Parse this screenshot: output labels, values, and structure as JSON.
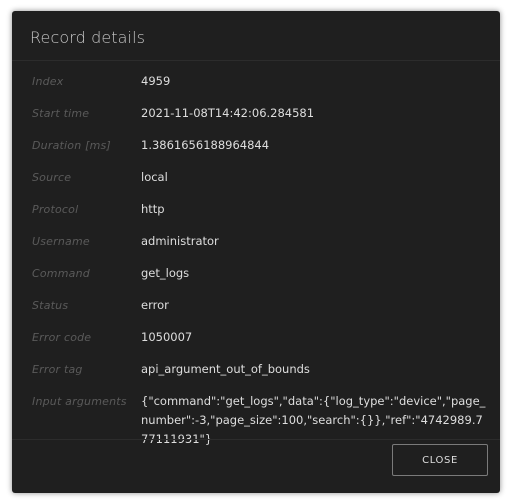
{
  "dialog": {
    "title": "Record details",
    "close_label": "CLOSE"
  },
  "fields": [
    {
      "label": "Index",
      "value": "4959"
    },
    {
      "label": "Start time",
      "value": "2021-11-08T14:42:06.284581"
    },
    {
      "label": "Duration [ms]",
      "value": "1.3861656188964844"
    },
    {
      "label": "Source",
      "value": "local"
    },
    {
      "label": "Protocol",
      "value": "http"
    },
    {
      "label": "Username",
      "value": "administrator"
    },
    {
      "label": "Command",
      "value": "get_logs"
    },
    {
      "label": "Status",
      "value": "error"
    },
    {
      "label": "Error code",
      "value": "1050007"
    },
    {
      "label": "Error tag",
      "value": "api_argument_out_of_bounds"
    },
    {
      "label": "Input arguments",
      "value": "{\"command\":\"get_logs\",\"data\":{\"log_type\":\"device\",\"page_number\":-3,\"page_size\":100,\"search\":{}},\"ref\":\"4742989.777111931\"}"
    }
  ]
}
